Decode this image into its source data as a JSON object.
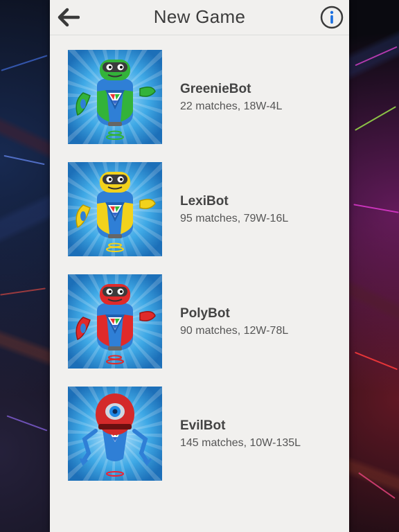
{
  "header": {
    "title": "New Game",
    "back_icon": "arrow-left-icon",
    "info_icon": "info-icon",
    "info_color": "#1a6fe0"
  },
  "bots": [
    {
      "name": "GreenieBot",
      "stats": "22 matches, 18W-4L",
      "color": "#33b33a",
      "dark": "#1c7d22"
    },
    {
      "name": "LexiBot",
      "stats": "95 matches, 79W-16L",
      "color": "#f2d21c",
      "dark": "#b89a00"
    },
    {
      "name": "PolyBot",
      "stats": "90 matches, 12W-78L",
      "color": "#e02a2a",
      "dark": "#9c1414"
    },
    {
      "name": "EvilBot",
      "stats": "145 matches, 10W-135L",
      "color": "#d42a2a",
      "dark": "#8e1010"
    }
  ]
}
